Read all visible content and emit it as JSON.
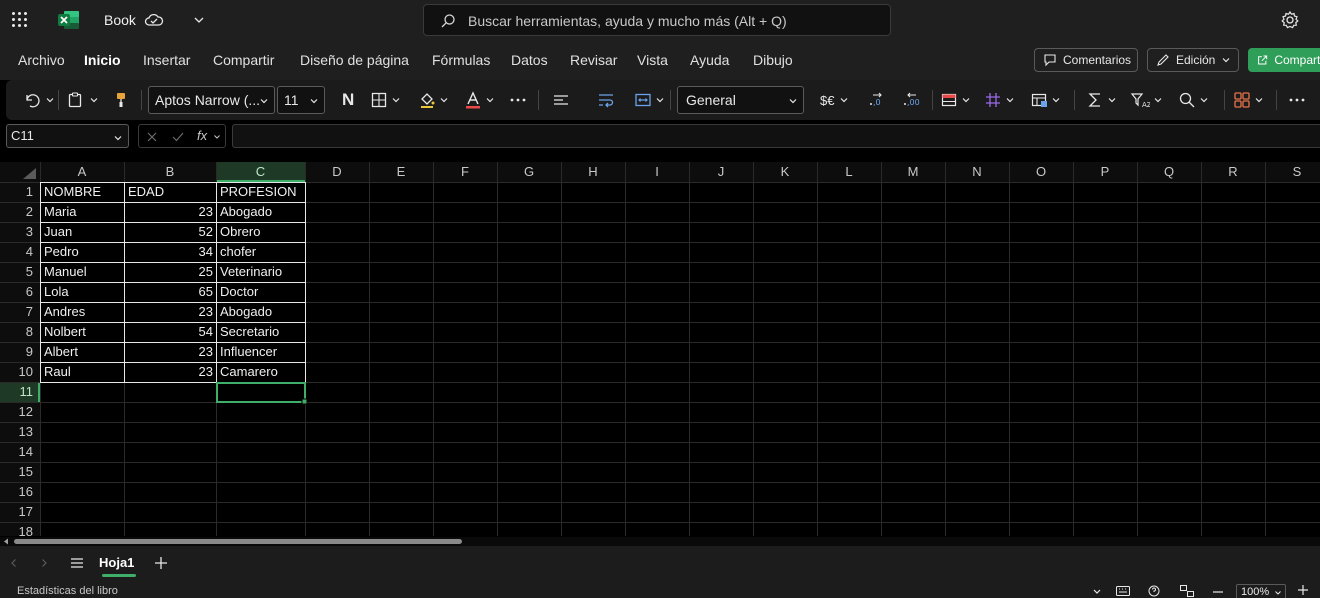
{
  "title_bar": {
    "document_name": "Book",
    "search_placeholder": "Buscar herramientas, ayuda y mucho más (Alt + Q)"
  },
  "menu": {
    "items": [
      "Archivo",
      "Inicio",
      "Insertar",
      "Compartir",
      "Diseño de página",
      "Fórmulas",
      "Datos",
      "Revisar",
      "Vista",
      "Ayuda",
      "Dibujo"
    ],
    "active": "Inicio",
    "comments_label": "Comentarios",
    "editing_label": "Edición",
    "share_label": "Compartir"
  },
  "ribbon": {
    "font_name": "Aptos Narrow (...",
    "font_size": "11",
    "bold_label": "N",
    "number_format": "General",
    "currency_label": "$€"
  },
  "formula_bar": {
    "name_box": "C11",
    "fx_label": "fx",
    "formula": ""
  },
  "sheet": {
    "columns": [
      "A",
      "B",
      "C",
      "D",
      "E",
      "F",
      "G",
      "H",
      "I",
      "J",
      "K",
      "L",
      "M",
      "N",
      "O",
      "P",
      "Q",
      "R",
      "S"
    ],
    "row_numbers": [
      "1",
      "2",
      "3",
      "4",
      "5",
      "6",
      "7",
      "8",
      "9",
      "10",
      "11",
      "12",
      "13",
      "14",
      "15",
      "16",
      "17",
      "18"
    ],
    "selected_column": "C",
    "selected_row": "11",
    "headers": [
      "NOMBRE",
      "EDAD",
      "PROFESION"
    ],
    "rows": [
      {
        "nombre": "Maria",
        "edad": "23",
        "profesion": "Abogado"
      },
      {
        "nombre": "Juan",
        "edad": "52",
        "profesion": "Obrero"
      },
      {
        "nombre": "Pedro",
        "edad": "34",
        "profesion": "chofer"
      },
      {
        "nombre": "Manuel",
        "edad": "25",
        "profesion": "Veterinario"
      },
      {
        "nombre": "Lola",
        "edad": "65",
        "profesion": "Doctor"
      },
      {
        "nombre": "Andres",
        "edad": "23",
        "profesion": "Abogado"
      },
      {
        "nombre": "Nolbert",
        "edad": "54",
        "profesion": "Secretario"
      },
      {
        "nombre": "Albert",
        "edad": "23",
        "profesion": "Influencer"
      },
      {
        "nombre": "Raul",
        "edad": "23",
        "profesion": "Camarero"
      }
    ]
  },
  "sheet_tabs": {
    "active": "Hoja1"
  },
  "status_bar": {
    "left_text": "Estadísticas del libro",
    "zoom": "100%"
  },
  "colors": {
    "excel_green": "#107c41",
    "accent_green": "#2f9e59",
    "selection_green": "#3fae68",
    "background": "#000000",
    "chrome": "#1f1f1f"
  }
}
